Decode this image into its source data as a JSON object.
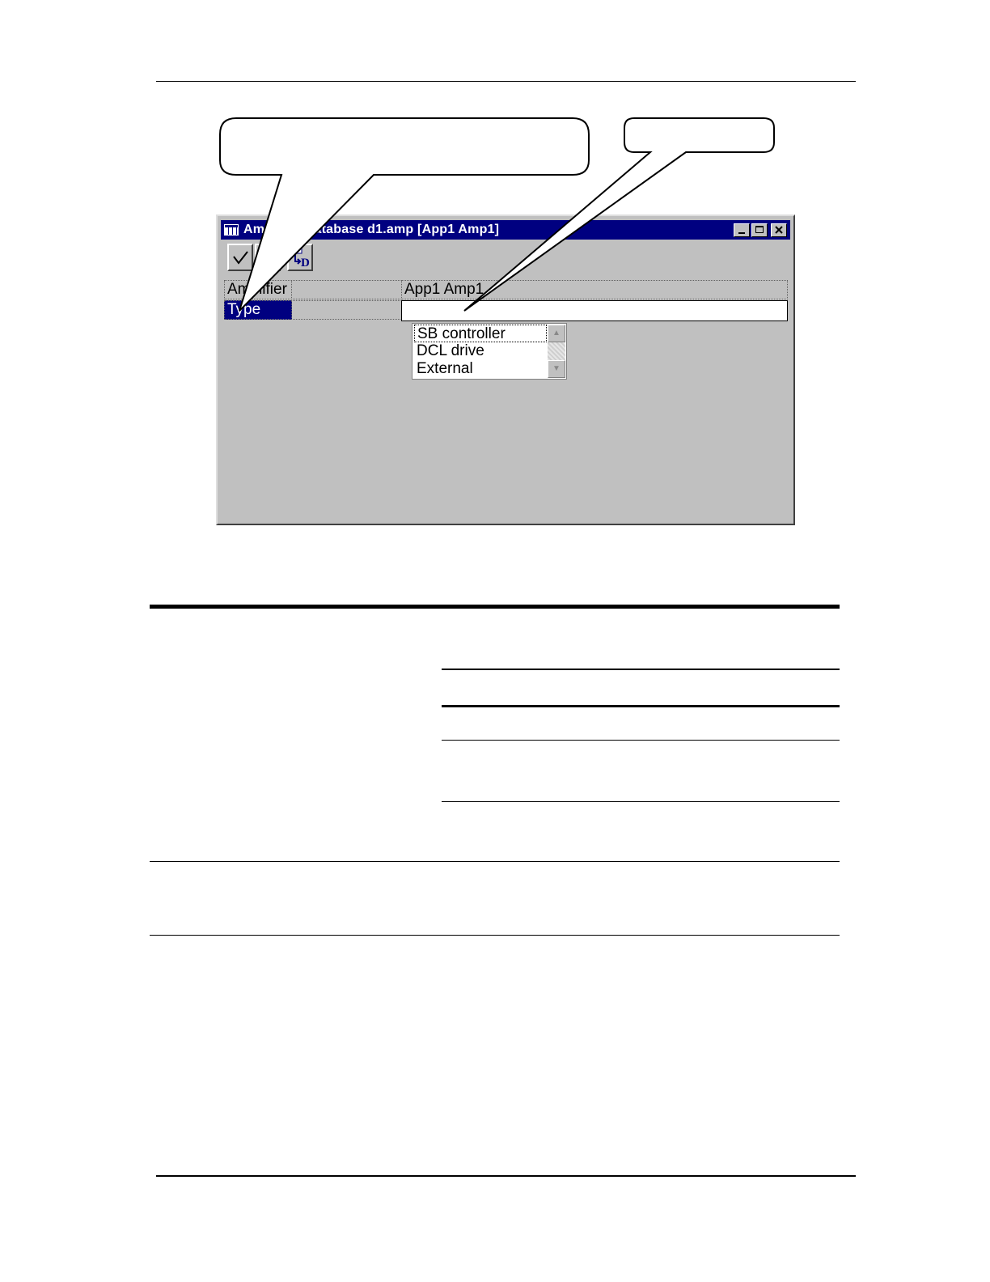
{
  "window": {
    "title": "Amplifier Database d1.amp [App1 Amp1]",
    "title_visible_parts": [
      "Am",
      "tabase d1.amp [App1 Amp1]"
    ],
    "caption_buttons": [
      "minimize",
      "maximize",
      "close"
    ]
  },
  "toolbar": {
    "buttons": [
      {
        "name": "apply-button",
        "icon": "checkmark-icon"
      },
      {
        "name": "second-button",
        "icon": "document-icon"
      },
      {
        "name": "download-button",
        "icon": "download-d-icon",
        "glyph": "D"
      }
    ]
  },
  "grid": {
    "header": {
      "col1": "Amplifier",
      "col2": "",
      "col3": "App1 Amp1"
    },
    "rows": [
      {
        "col1": "Type",
        "col2": "",
        "col3": ""
      }
    ]
  },
  "dropdown": {
    "options": [
      "SB controller",
      "DCL drive",
      "External"
    ],
    "selected": "SB controller"
  },
  "colors": {
    "title_bar": "#000080",
    "window_face": "#c0c0c0",
    "selection": "#000080"
  }
}
